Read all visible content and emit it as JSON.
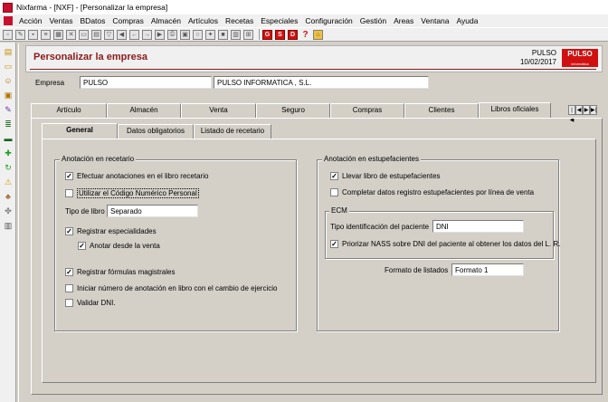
{
  "window": {
    "title": "Nixfarma - [NXF] - [Personalizar la empresa]"
  },
  "menu": [
    "Acción",
    "Ventas",
    "BDatos",
    "Compras",
    "Almacén",
    "Artículos",
    "Recetas",
    "Especiales",
    "Configuración",
    "Gestión",
    "Areas",
    "Ventana",
    "Ayuda"
  ],
  "toolbar": {
    "s_label": "S",
    "g_label": "G",
    "d_label": "D",
    "help_label": "?"
  },
  "header": {
    "title": "Personalizar la empresa",
    "brand": "PULSO",
    "date": "10/02/2017",
    "logo": "PULSO",
    "logo_sub": "informática"
  },
  "empresa": {
    "label": "Empresa",
    "code": "PULSO",
    "name": "PULSO INFORMATICA , S.L."
  },
  "tabs": [
    "Artículo",
    "Almacén",
    "Venta",
    "Seguro",
    "Compras",
    "Clientes",
    "Libros oficiales"
  ],
  "subtabs": [
    "General",
    "Datos obligatorios",
    "Listado de recetario"
  ],
  "recetario": {
    "legend": "Anotación en recetario",
    "efectuar": "Efectuar anotaciones en el libro recetario",
    "codigo": "Utilizar el Código Numérico Personal",
    "tipo_label": "Tipo de libro",
    "tipo_value": "Separado",
    "especialidades": "Registrar especialidades",
    "anotar": "Anotar desde la venta",
    "formulas": "Registrar fórmulas magistrales",
    "iniciar": "Iniciar número de anotación en libro con el cambio de ejercicio",
    "validar": "Validar DNI."
  },
  "estupefacientes": {
    "legend": "Anotación en  estupefacientes",
    "llevar": "Llevar libro de estupefacientes",
    "completar": "Completar datos registro estupefacientes por línea de venta",
    "ecm_legend": "ECM",
    "tipo_label": "Tipo identificación del paciente",
    "tipo_value": "DNI",
    "priorizar": "Priorizar NASS sobre DNI del paciente al obtener los datos del L. R.",
    "formato_label": "Formato de listados",
    "formato_value": "Formato 1"
  },
  "checks": {
    "efectuar": true,
    "codigo": false,
    "especialidades": true,
    "anotar": true,
    "formulas": true,
    "iniciar": false,
    "validar": false,
    "llevar": true,
    "completar": false,
    "priorizar": true
  }
}
